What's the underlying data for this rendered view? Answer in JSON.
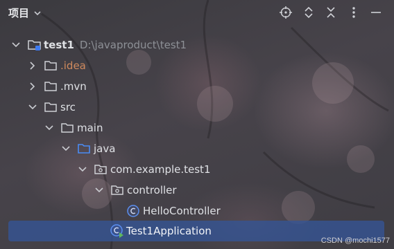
{
  "header": {
    "title": "项目",
    "tools": [
      "crosshair-icon",
      "expand-icon",
      "collapse-icon",
      "more-icon",
      "minimize-icon"
    ]
  },
  "tree": {
    "root": {
      "name": "test1",
      "path": "D:\\javaproduct\\test1"
    },
    "items": [
      {
        "label": ".idea",
        "color": "#d08a5d",
        "state": "collapsed"
      },
      {
        "label": ".mvn",
        "state": "collapsed"
      },
      {
        "label": "src",
        "state": "expanded"
      },
      {
        "label": "main",
        "state": "expanded"
      },
      {
        "label": "java",
        "state": "expanded",
        "color_icon": "#4a8cf5"
      },
      {
        "label": "com.example.test1",
        "state": "expanded"
      },
      {
        "label": "controller",
        "state": "expanded"
      },
      {
        "label": "HelloController",
        "type": "class"
      },
      {
        "label": "Test1Application",
        "type": "spring-class",
        "selected": true
      }
    ]
  },
  "watermark": "CSDN @mochi1577"
}
